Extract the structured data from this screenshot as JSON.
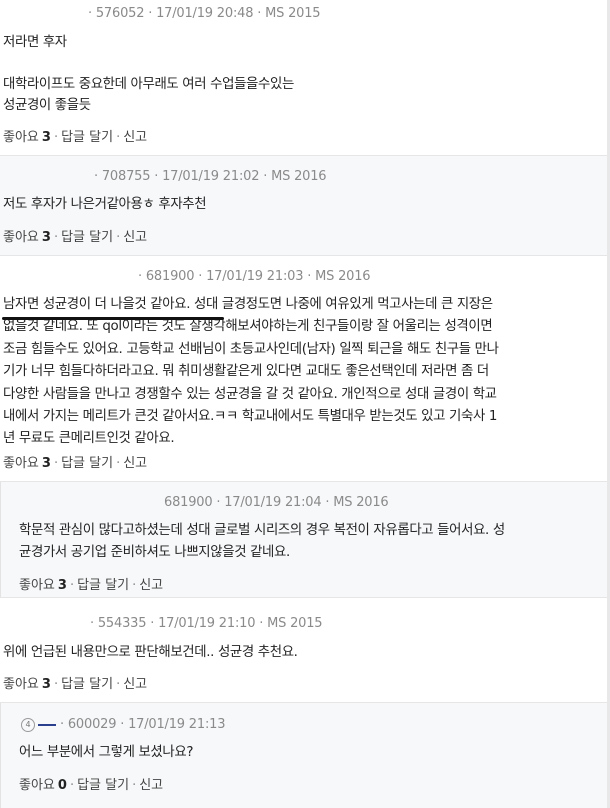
{
  "comments": [
    {
      "id": "576052",
      "date": "17/01/19 20:48",
      "meta": "· 576052 · 17/01/19 20:48 · MS 2015",
      "lines": [
        "저라면 후자",
        "",
        "대학라이프도 중요한데 아무래도 여러 수업들을수있는",
        "성균경이 좋을듯"
      ],
      "like_label": "좋아요",
      "like_count": "3",
      "reply_label": "답글 달기",
      "report_label": "신고"
    },
    {
      "id": "708755",
      "meta": "· 708755 · 17/01/19 21:02 · MS 2016",
      "lines": [
        "저도 후자가 나은거같아용ㅎ 후자추천"
      ],
      "like_label": "좋아요",
      "like_count": "3",
      "reply_label": "답글 달기",
      "report_label": "신고"
    },
    {
      "id": "681900",
      "meta": "· 681900 · 17/01/19 21:03 · MS 2016",
      "lines": [
        "남자면 성균경이 더 나을것 같아요. 성대 글경정도면 나중에 여유있게 먹고사는데 큰 지장은",
        "없을것 같네요. 또 qol이라는 것도 잘생각해보셔야하는게 친구들이랑 잘 어울리는 성격이면",
        "조금 힘들수도 있어요. 고등학교 선배님이 초등교사인데(남자) 일찍 퇴근을 해도 친구들 만나",
        "기가 너무 힘들다하더라고요. 뭐 취미생활같은게 있다면 교대도 좋은선택인데 저라면 좀 더",
        "다양한 사람들을 만나고 경쟁할수 있는 성균경을 갈 것 같아요. 개인적으로 성대 글경이 학교",
        "내에서 가지는 메리트가 큰것 같아서요.ㅋㅋ 학교내에서도 특별대우 받는것도 있고 기숙사 1",
        "년 무료도 큰메리트인것 같아요."
      ],
      "like_label": "좋아요",
      "like_count": "3",
      "reply_label": "답글 달기",
      "report_label": "신고"
    },
    {
      "id": "681900-reply",
      "meta": "681900 · 17/01/19 21:04 · MS 2016",
      "lines": [
        "학문적 관심이 많다고하셨는데 성대 글로벌 시리즈의 경우 복전이 자유롭다고 들어서요. 성",
        "균경가서 공기업 준비하셔도 나쁘지않을것 같네요."
      ],
      "like_label": "좋아요",
      "like_count": "3",
      "reply_label": "답글 달기",
      "report_label": "신고"
    },
    {
      "id": "554335",
      "meta": "· 554335 · 17/01/19 21:10 · MS 2015",
      "lines": [
        "위에 언급된 내용만으로 판단해보건데.. 성균경 추천요."
      ],
      "like_label": "좋아요",
      "like_count": "3",
      "reply_label": "답글 달기",
      "report_label": "신고"
    },
    {
      "id": "600029",
      "badge": "4",
      "meta": "· 600029 · 17/01/19 21:13",
      "lines": [
        "어느 부분에서 그렇게 보셨나요?"
      ],
      "like_label": "좋아요",
      "like_count": "0",
      "reply_label": "답글 달기",
      "report_label": "신고"
    }
  ]
}
